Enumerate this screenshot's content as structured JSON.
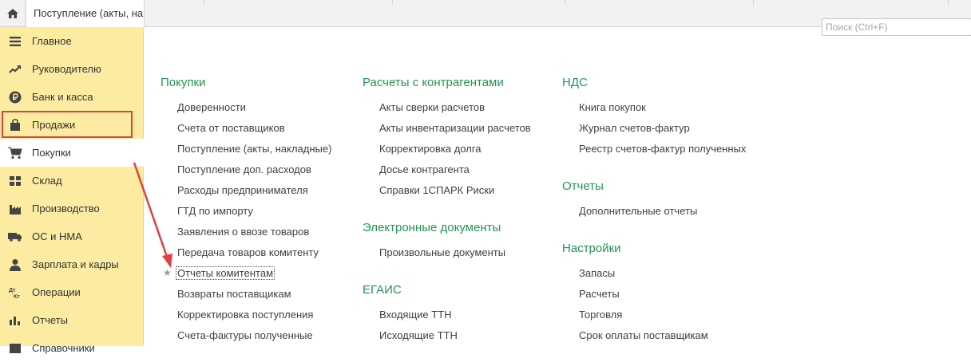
{
  "topbar": {
    "active_tab": "Поступление (акты, накладные)"
  },
  "search": {
    "placeholder": "Поиск (Ctrl+F)"
  },
  "sidebar": {
    "items": [
      {
        "label": "Главное",
        "icon": "menu-icon"
      },
      {
        "label": "Руководителю",
        "icon": "trend-icon"
      },
      {
        "label": "Банк и касса",
        "icon": "ruble-icon"
      },
      {
        "label": "Продажи",
        "icon": "bag-icon"
      },
      {
        "label": "Покупки",
        "icon": "cart-icon"
      },
      {
        "label": "Склад",
        "icon": "warehouse-icon"
      },
      {
        "label": "Производство",
        "icon": "factory-icon"
      },
      {
        "label": "ОС и НМА",
        "icon": "truck-icon"
      },
      {
        "label": "Зарплата и кадры",
        "icon": "person-icon"
      },
      {
        "label": "Операции",
        "icon": "dt-kt-icon"
      },
      {
        "label": "Отчеты",
        "icon": "bar-chart-icon"
      },
      {
        "label": "Справочники",
        "icon": "book-icon"
      }
    ]
  },
  "columns": {
    "purchases": {
      "title": "Покупки",
      "links": [
        "Доверенности",
        "Счета от поставщиков",
        "Поступление (акты, накладные)",
        "Поступление доп. расходов",
        "Расходы предпринимателя",
        "ГТД по импорту",
        "Заявления о ввозе товаров",
        "Передача товаров комитенту",
        "Отчеты комитентам",
        "Возвраты поставщикам",
        "Корректировка поступления",
        "Счета-фактуры полученные"
      ]
    },
    "settlements": {
      "title": "Расчеты с контрагентами",
      "links": [
        "Акты сверки расчетов",
        "Акты инвентаризации расчетов",
        "Корректировка долга",
        "Досье контрагента",
        "Справки 1СПАРК Риски"
      ]
    },
    "edocs": {
      "title": "Электронные документы",
      "links": [
        "Произвольные документы"
      ]
    },
    "egais": {
      "title": "ЕГАИС",
      "links": [
        "Входящие ТТН",
        "Исходящие ТТН"
      ]
    },
    "vat": {
      "title": "НДС",
      "links": [
        "Книга покупок",
        "Журнал счетов-фактур",
        "Реестр счетов-фактур полученных"
      ]
    },
    "reports": {
      "title": "Отчеты",
      "links": [
        "Дополнительные отчеты"
      ]
    },
    "settings": {
      "title": "Настройки",
      "links": [
        "Запасы",
        "Расчеты",
        "Торговля",
        "Срок оплаты поставщикам"
      ]
    }
  },
  "colors": {
    "sidebar_bg": "#fbeca1",
    "section_title": "#219653",
    "highlight": "#e04040"
  }
}
